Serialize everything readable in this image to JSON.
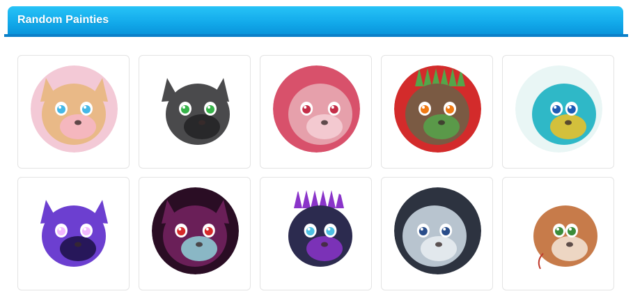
{
  "header": {
    "title": "Random Painties",
    "accent_color": "#1aaff0",
    "rule_color": "#0b7fc8"
  },
  "painties": [
    {
      "icon": "pink-fluffy-creature-avatar-icon",
      "bg": "#f3c9d6",
      "fur": "#e9b987",
      "eye": "#45b8e6",
      "accent": "#f7b6c8"
    },
    {
      "icon": "grey-wolf-avatar-icon",
      "bg": "#ffffff",
      "fur": "#4a4a4c",
      "eye": "#37b34a",
      "accent": "#222224"
    },
    {
      "icon": "pink-pony-avatar-icon",
      "bg": "#d8516b",
      "fur": "#e6a0ab",
      "eye": "#c42e48",
      "accent": "#f5d0d6"
    },
    {
      "icon": "green-goblin-creature-avatar-icon",
      "bg": "#d32b2b",
      "fur": "#7a5a43",
      "eye": "#f07a14",
      "accent": "#55a54a"
    },
    {
      "icon": "rainbow-lizard-avatar-icon",
      "bg": "#e9f6f5",
      "fur": "#2fb8c7",
      "eye": "#1e5bb5",
      "accent": "#f0c123"
    },
    {
      "icon": "purple-galaxy-cat-avatar-icon",
      "bg": "#ffffff",
      "fur": "#6c3fd0",
      "eye": "#f2b8ff",
      "accent": "#1b1045"
    },
    {
      "icon": "dark-magenta-plush-avatar-icon",
      "bg": "#2a0d24",
      "fur": "#6a1f58",
      "eye": "#d62a2a",
      "accent": "#8fd2d8"
    },
    {
      "icon": "blue-spiked-dragon-avatar-icon",
      "bg": "#ffffff",
      "fur": "#2c2b4f",
      "eye": "#4ec0e3",
      "accent": "#8a34c9"
    },
    {
      "icon": "light-blue-dragon-avatar-icon",
      "bg": "#2d3340",
      "fur": "#b8c4cf",
      "eye": "#2a4d8a",
      "accent": "#e9eef2"
    },
    {
      "icon": "brown-snake-avatar-icon",
      "bg": "#ffffff",
      "fur": "#c77b4a",
      "eye": "#3a8c39",
      "accent": "#f3e6d8"
    }
  ]
}
